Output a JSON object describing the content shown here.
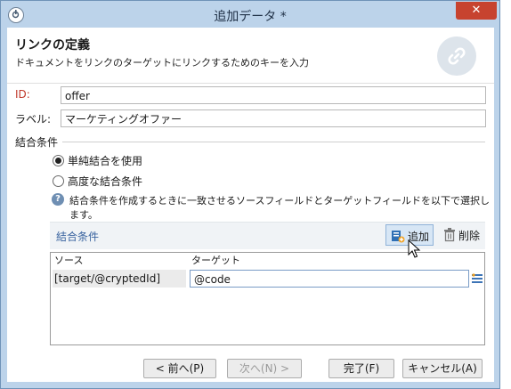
{
  "window": {
    "title": "追加データ *",
    "close_label": "✕"
  },
  "header": {
    "title": "リンクの定義",
    "subtitle": "ドキュメントをリンクのターゲットにリンクするためのキーを入力",
    "icon": "link-icon"
  },
  "form": {
    "id_label": "ID:",
    "id_value": "offer",
    "label_label": "ラベル:",
    "label_value": "マーケティングオファー",
    "id_label_color": "#c0392b"
  },
  "join": {
    "section_title": "結合条件",
    "options": [
      {
        "label": "単純結合を使用",
        "selected": true
      },
      {
        "label": "高度な結合条件",
        "selected": false
      }
    ],
    "help_text": "結合条件を作成するときに一致させるソースフィールドとターゲットフィールドを以下で選択します。"
  },
  "conditions": {
    "toolbar_title": "結合条件",
    "add_label": "追加",
    "delete_label": "削除",
    "columns": [
      "ソース",
      "ターゲット"
    ],
    "rows": [
      {
        "source": "[target/@cryptedId]",
        "target": "@code"
      }
    ]
  },
  "footer": {
    "prev": "< 前へ(P)",
    "next": "次へ(N) >",
    "finish": "完了(F)",
    "cancel": "キャンセル(A)"
  },
  "colors": {
    "accent": "#3a64a0",
    "titlebar": "#bcd3ea",
    "close": "#c7432f"
  }
}
